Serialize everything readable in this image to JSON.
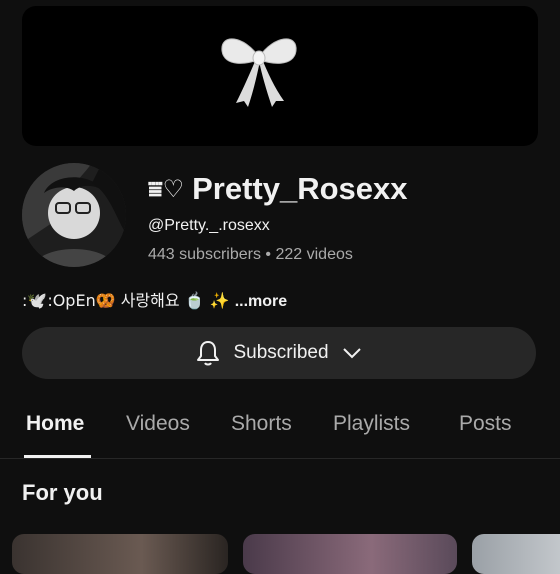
{
  "channel": {
    "title": "Pretty_Rosexx",
    "title_decoration": "⩸♡",
    "handle": "@Pretty._.rosexx",
    "subscribers": "443 subscribers",
    "separator": "•",
    "videos": "222 videos",
    "description": ":🕊️:OpEn🥨 사랑해요 🍵 ✨",
    "more_label": "...more"
  },
  "subscribe_button": {
    "label": "Subscribed"
  },
  "tabs": [
    {
      "label": "Home",
      "active": true
    },
    {
      "label": "Videos",
      "active": false
    },
    {
      "label": "Shorts",
      "active": false
    },
    {
      "label": "Playlists",
      "active": false
    },
    {
      "label": "Posts",
      "active": false
    }
  ],
  "section": {
    "title": "For you"
  },
  "icons": {
    "banner": "bow-icon",
    "subscribe": "bell-icon",
    "dropdown": "chevron-down-icon"
  },
  "colors": {
    "background": "#0f0f0f",
    "button": "#272727",
    "secondary_text": "#aaaaaa"
  }
}
